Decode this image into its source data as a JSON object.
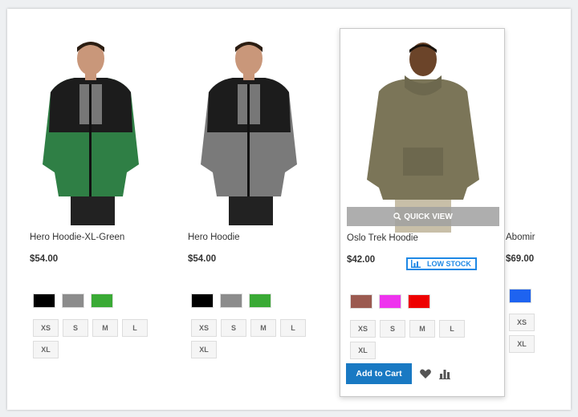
{
  "products": [
    {
      "name": "Hero Hoodie-XL-Green",
      "price": "$54.00",
      "swatch_colors": [
        "#000000",
        "#8c8c8c",
        "#3aaa35"
      ],
      "sizes": [
        "XS",
        "S",
        "M",
        "L",
        "XL"
      ],
      "body_color": "#2f7f45",
      "top_color": "#1c1c1c"
    },
    {
      "name": "Hero Hoodie",
      "price": "$54.00",
      "swatch_colors": [
        "#000000",
        "#8c8c8c",
        "#3aaa35"
      ],
      "sizes": [
        "XS",
        "S",
        "M",
        "L",
        "XL"
      ],
      "body_color": "#7a7a7a",
      "top_color": "#1c1c1c"
    },
    {
      "name": "Oslo Trek Hoodie",
      "price": "$42.00",
      "swatch_colors": [
        "#9b5a50",
        "#ee33ee",
        "#ee0000"
      ],
      "sizes": [
        "XS",
        "S",
        "M",
        "L",
        "XL"
      ],
      "quick_view_label": "QUICK VIEW",
      "stock_badge": "LOW STOCK",
      "add_to_cart_label": "Add to Cart",
      "body_color": "#7b7558"
    },
    {
      "name": "Abomir",
      "price": "$69.00",
      "swatch_colors": [
        "#1e63f0"
      ],
      "sizes": [
        "XS",
        "XL"
      ]
    }
  ],
  "accent_color": "#1979c3",
  "badge_color": "#1e88e5"
}
